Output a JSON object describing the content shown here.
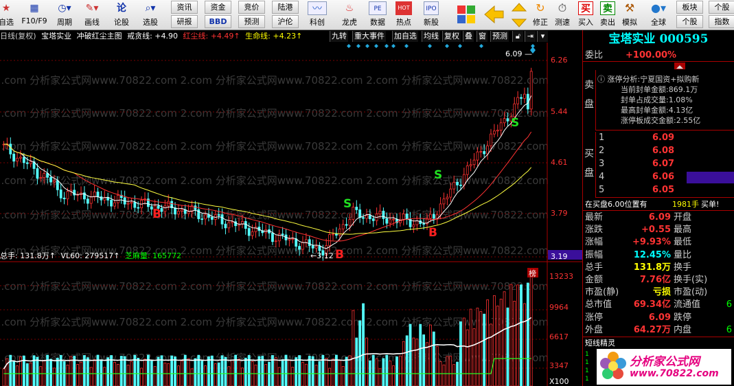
{
  "toolbar": {
    "buttons": [
      {
        "label": "自选",
        "icon": "star-icon"
      },
      {
        "label": "F10/F9",
        "icon": "calendar-icon"
      },
      {
        "label": "周期",
        "icon": "clock-icon"
      },
      {
        "label": "画线",
        "icon": "pencil-icon"
      },
      {
        "label": "论股",
        "icon": "discuss-icon"
      },
      {
        "label": "选股",
        "icon": "magnifier-icon"
      }
    ],
    "grid_buttons": [
      "资讯",
      "资金",
      "竞价",
      "陆港",
      "研报",
      "BBD",
      "预测",
      "沪伦"
    ],
    "app_buttons": [
      {
        "label": "科创",
        "icon": "chart-icon"
      },
      {
        "label": "龙虎",
        "icon": "dragon-icon"
      },
      {
        "label": "数据",
        "icon": "pe-icon"
      },
      {
        "label": "热点",
        "icon": "hot-icon"
      },
      {
        "label": "新股",
        "icon": "ipo-icon"
      }
    ],
    "right_buttons": [
      {
        "label": "",
        "icon": "mosaic-icon"
      },
      {
        "label": "",
        "icon": "back-arrow-icon"
      },
      {
        "label": "",
        "icon": "up-down-arrow-icon"
      },
      {
        "label": "修正",
        "icon": "recycle-icon"
      },
      {
        "label": "测速",
        "icon": "stopwatch-icon"
      },
      {
        "label": "买入",
        "icon": "buy-icon",
        "glyph": "买"
      },
      {
        "label": "卖出",
        "icon": "sell-icon",
        "glyph": "卖"
      },
      {
        "label": "模拟",
        "icon": "hammer-icon"
      },
      {
        "label": "全球",
        "icon": "globe-icon"
      }
    ],
    "far_right": [
      "板块",
      "个股",
      "指数"
    ]
  },
  "chart_header": {
    "period": "日线(复权)",
    "stock": "宝塔实业",
    "formula": "冲破红尘主图",
    "line1": "戒贪线: +4.90",
    "line2": "红尘线: +4.49↑",
    "line3": "生命线: +4.23↑",
    "menu": [
      "九转",
      "重大事件",
      "加自选",
      "均线",
      "复权",
      "叠",
      "窗",
      "预测"
    ]
  },
  "price_axis": [
    "6.26",
    "5.44",
    "4.61",
    "3.79",
    "3.19"
  ],
  "annotations": {
    "high": "6.09",
    "low": "3.12",
    "bang": "榜"
  },
  "volume_header": {
    "total": "总手: 131.8万↑",
    "vl60": "VL60: 279517↑",
    "zhima": "芝麻量: 165772"
  },
  "volume_axis": [
    "13233",
    "9964",
    "6617",
    "3347",
    "X100"
  ],
  "watermark": "2.com 分析家公式网www.70822.com",
  "stock_title": "宝塔实业 000595",
  "weibi": {
    "label": "委比",
    "value": "+100.00%"
  },
  "sell_side": {
    "label": "卖盘",
    "analysis_title": "涨停分析:宁夏国资+拟购新",
    "lines": [
      "当前封单金额:869.1万",
      "封单占成交量:1.08%",
      "最高封单金额:4.13亿",
      "涨停板成交金额:2.55亿"
    ]
  },
  "buy_side": {
    "label": "买盘",
    "levels": [
      {
        "n": "1",
        "price": "6.09"
      },
      {
        "n": "2",
        "price": "6.08"
      },
      {
        "n": "3",
        "price": "6.07"
      },
      {
        "n": "4",
        "price": "6.06"
      },
      {
        "n": "5",
        "price": "6.05"
      }
    ]
  },
  "queue_line": {
    "text": "在买盘6.00位置有",
    "vol": "1981手",
    "action": "买单!"
  },
  "quote_rows": [
    {
      "k1": "最新",
      "v1": "6.09",
      "k2": "开盘",
      "v2": ""
    },
    {
      "k1": "涨跌",
      "v1": "+0.55",
      "k2": "最高",
      "v2": ""
    },
    {
      "k1": "涨幅",
      "v1": "+9.93%",
      "k2": "最低",
      "v2": ""
    },
    {
      "k1": "振幅",
      "v1": "12.45%",
      "k2": "量比",
      "v2": ""
    },
    {
      "k1": "总手",
      "v1": "131.8万",
      "k2": "换手",
      "v2": ""
    },
    {
      "k1": "金额",
      "v1": "7.76亿",
      "k2": "换手(实)",
      "v2": ""
    },
    {
      "k1": "市盈(静)",
      "v1": "亏损",
      "k2": "市盈(动)",
      "v2": ""
    },
    {
      "k1": "总市值",
      "v1": "69.34亿",
      "k2": "流通值",
      "v2": "6"
    },
    {
      "k1": "涨停",
      "v1": "6.09",
      "k2": "跌停",
      "v2": ""
    },
    {
      "k1": "外盘",
      "v1": "64.27万",
      "k2": "内盘",
      "v2": "6"
    }
  ],
  "short_elf": {
    "title": "短线精灵",
    "logo": "分析家公式网",
    "url": "www.70822.com"
  },
  "colors": {
    "up": "#ff3232",
    "down": "#54ffff",
    "accent": "#ffff00",
    "bg": "#000000"
  }
}
